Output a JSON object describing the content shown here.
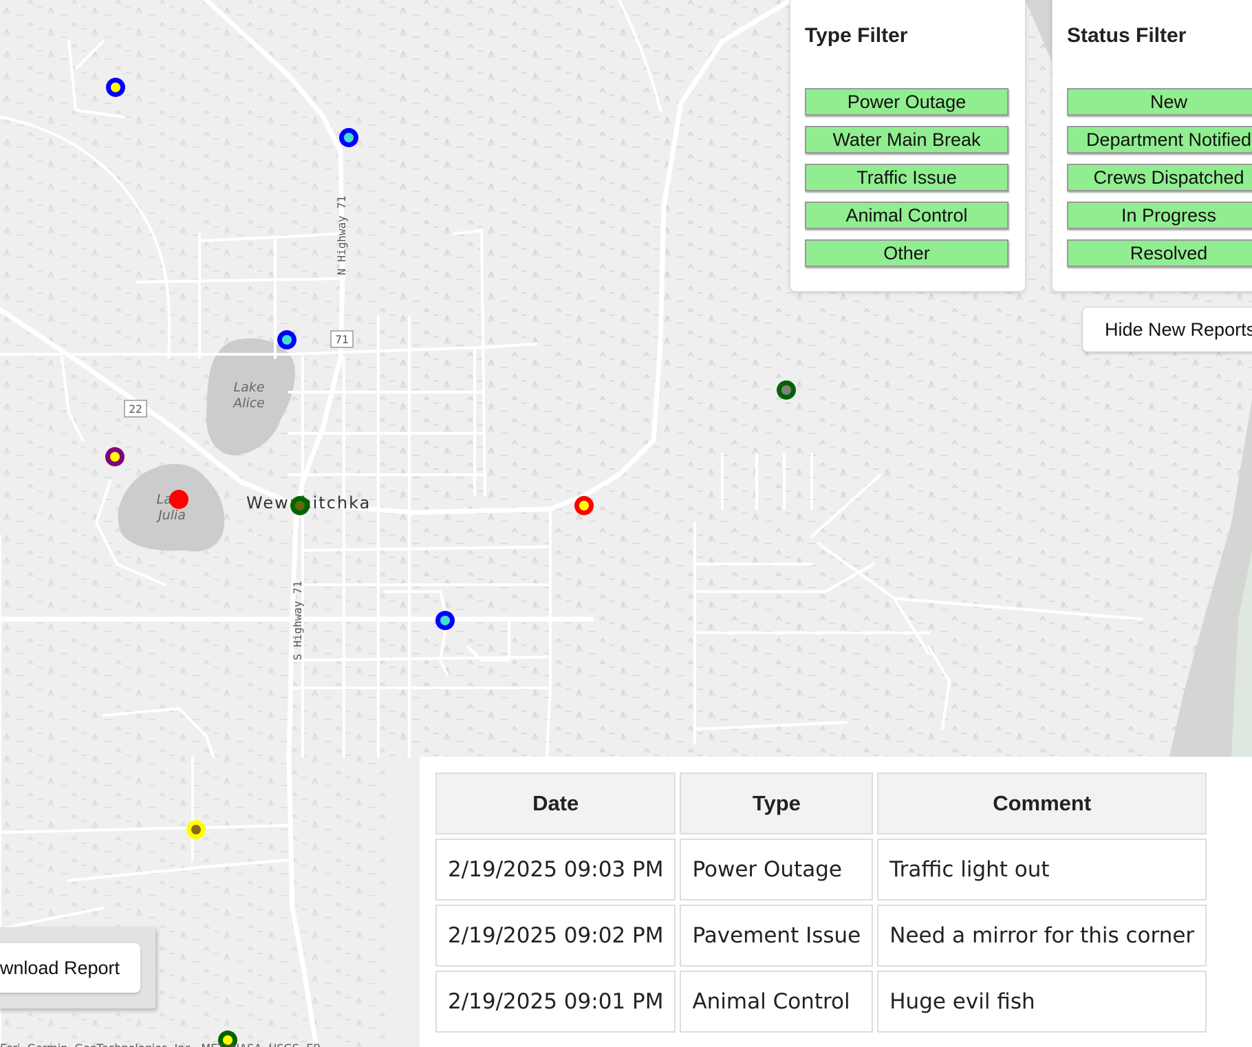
{
  "map": {
    "town_label": "Wewahitchka",
    "lakes": [
      "Lake Alice",
      "Lake Julia"
    ],
    "road_labels": {
      "n_highway": "N Highway 71",
      "s_highway": "S Highway 71",
      "shield_71": "71",
      "shield_22": "22"
    },
    "attribution": "Esri, Garmin, GeoTechnologies, Inc., METI/NASA, USGS, EP"
  },
  "type_filter": {
    "title": "Type Filter",
    "options": [
      "Power Outage",
      "Water Main Break",
      "Traffic Issue",
      "Animal Control",
      "Other"
    ]
  },
  "status_filter": {
    "title": "Status Filter",
    "options": [
      "New",
      "Department Notified",
      "Crews Dispatched",
      "In Progress",
      "Resolved"
    ]
  },
  "hide_button_label": "Hide New Reports",
  "download_button_label": "Download Report",
  "report_table": {
    "headers": [
      "Date",
      "Type",
      "Comment"
    ],
    "rows": [
      [
        "2/19/2025 09:03 PM",
        "Power Outage",
        "Traffic light out"
      ],
      [
        "2/19/2025 09:02 PM",
        "Pavement Issue",
        "Need a mirror for this corner"
      ],
      [
        "2/19/2025 09:01 PM",
        "Animal Control",
        "Huge evil fish"
      ]
    ]
  },
  "colors": {
    "filter_active": "#90ee90",
    "marker_blue_ring": "#0000ff",
    "marker_yellow_core": "#ffff00",
    "marker_cyan_core": "#40e0d0",
    "marker_red_ring": "#ff0000",
    "marker_green_ring": "#006400",
    "marker_purple_ring": "#800080",
    "marker_gray_core": "#808080",
    "marker_brown_core": "#8b6914"
  }
}
